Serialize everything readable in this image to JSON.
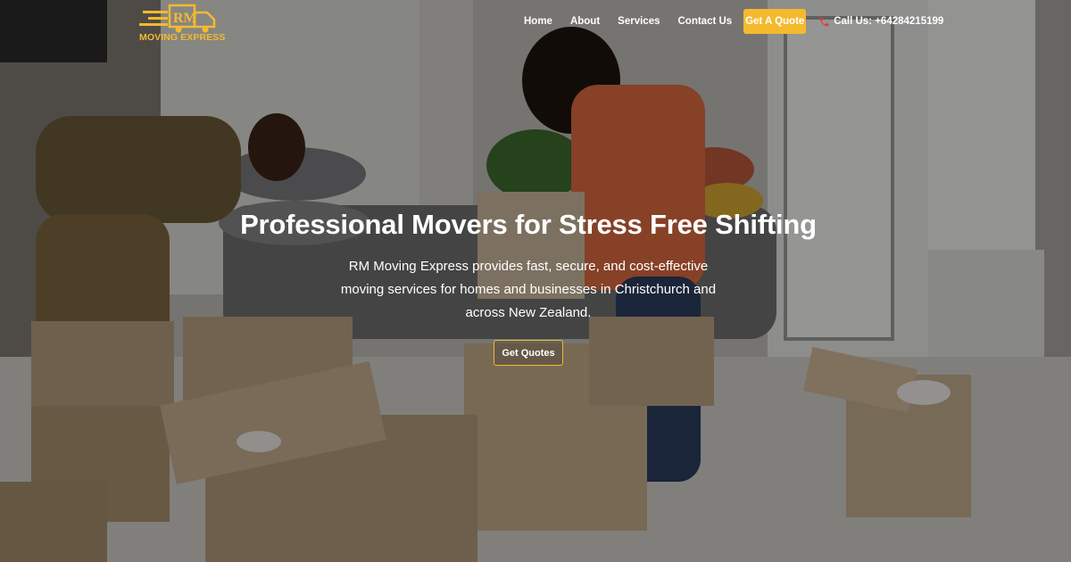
{
  "brand": {
    "monogram": "RM",
    "name": "MOVING EXPRESS",
    "accent_color": "#f5b92e"
  },
  "nav": {
    "links": [
      "Home",
      "About",
      "Services",
      "Contact Us"
    ],
    "quote_label": "Get A Quote",
    "call_label": "Call Us: +64284215199",
    "call_icon": "phone-icon"
  },
  "hero": {
    "headline": "Professional Movers for Stress Free Shifting",
    "subtitle": "RM Moving Express provides fast, secure, and cost-effective moving services for homes and businesses in Christchurch and across New Zealand.",
    "cta_label": "Get Quotes",
    "background": "photo of two people packing cardboard moving boxes in a bright living room"
  }
}
